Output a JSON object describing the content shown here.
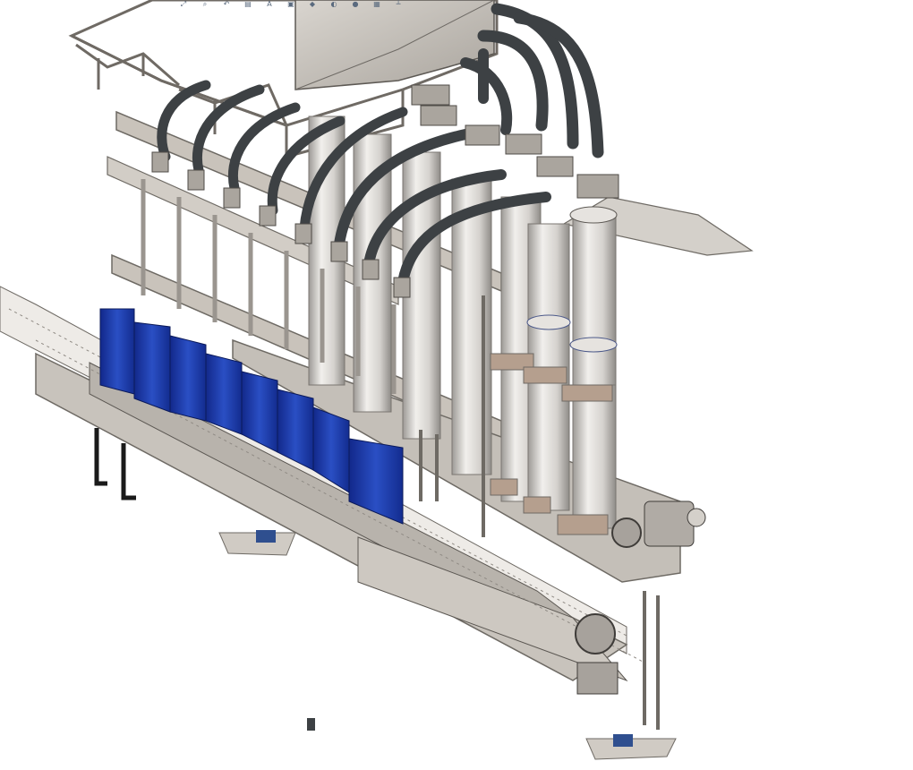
{
  "viewport": {
    "name": "3D model viewport",
    "feature_tree_label": "",
    "background": "#ffffff"
  },
  "heads_up_toolbar": {
    "buttons": [
      {
        "icon": "zoom-to-fit-icon",
        "glyph": "⤢"
      },
      {
        "icon": "zoom-area-icon",
        "glyph": "⌕"
      },
      {
        "icon": "previous-view-icon",
        "glyph": "↶"
      },
      {
        "icon": "section-view-icon",
        "glyph": "▤"
      },
      {
        "icon": "dynamic-annotation-icon",
        "glyph": "A"
      },
      {
        "icon": "view-orientation-icon",
        "glyph": "▣"
      },
      {
        "icon": "display-style-icon",
        "glyph": "◆"
      },
      {
        "icon": "hide-show-icon",
        "glyph": "◐"
      },
      {
        "icon": "edit-appearance-icon",
        "glyph": "●"
      },
      {
        "icon": "apply-scene-icon",
        "glyph": "▦"
      },
      {
        "icon": "view-settings-icon",
        "glyph": "┴"
      }
    ]
  },
  "colors": {
    "steel": "#c9c3bb",
    "steel_dark": "#8a857f",
    "hose": "#3d4144",
    "cylinder": "#d8d6d2",
    "container_blue": "#1f3fa8",
    "foot_pad": "#2f4f8f"
  }
}
